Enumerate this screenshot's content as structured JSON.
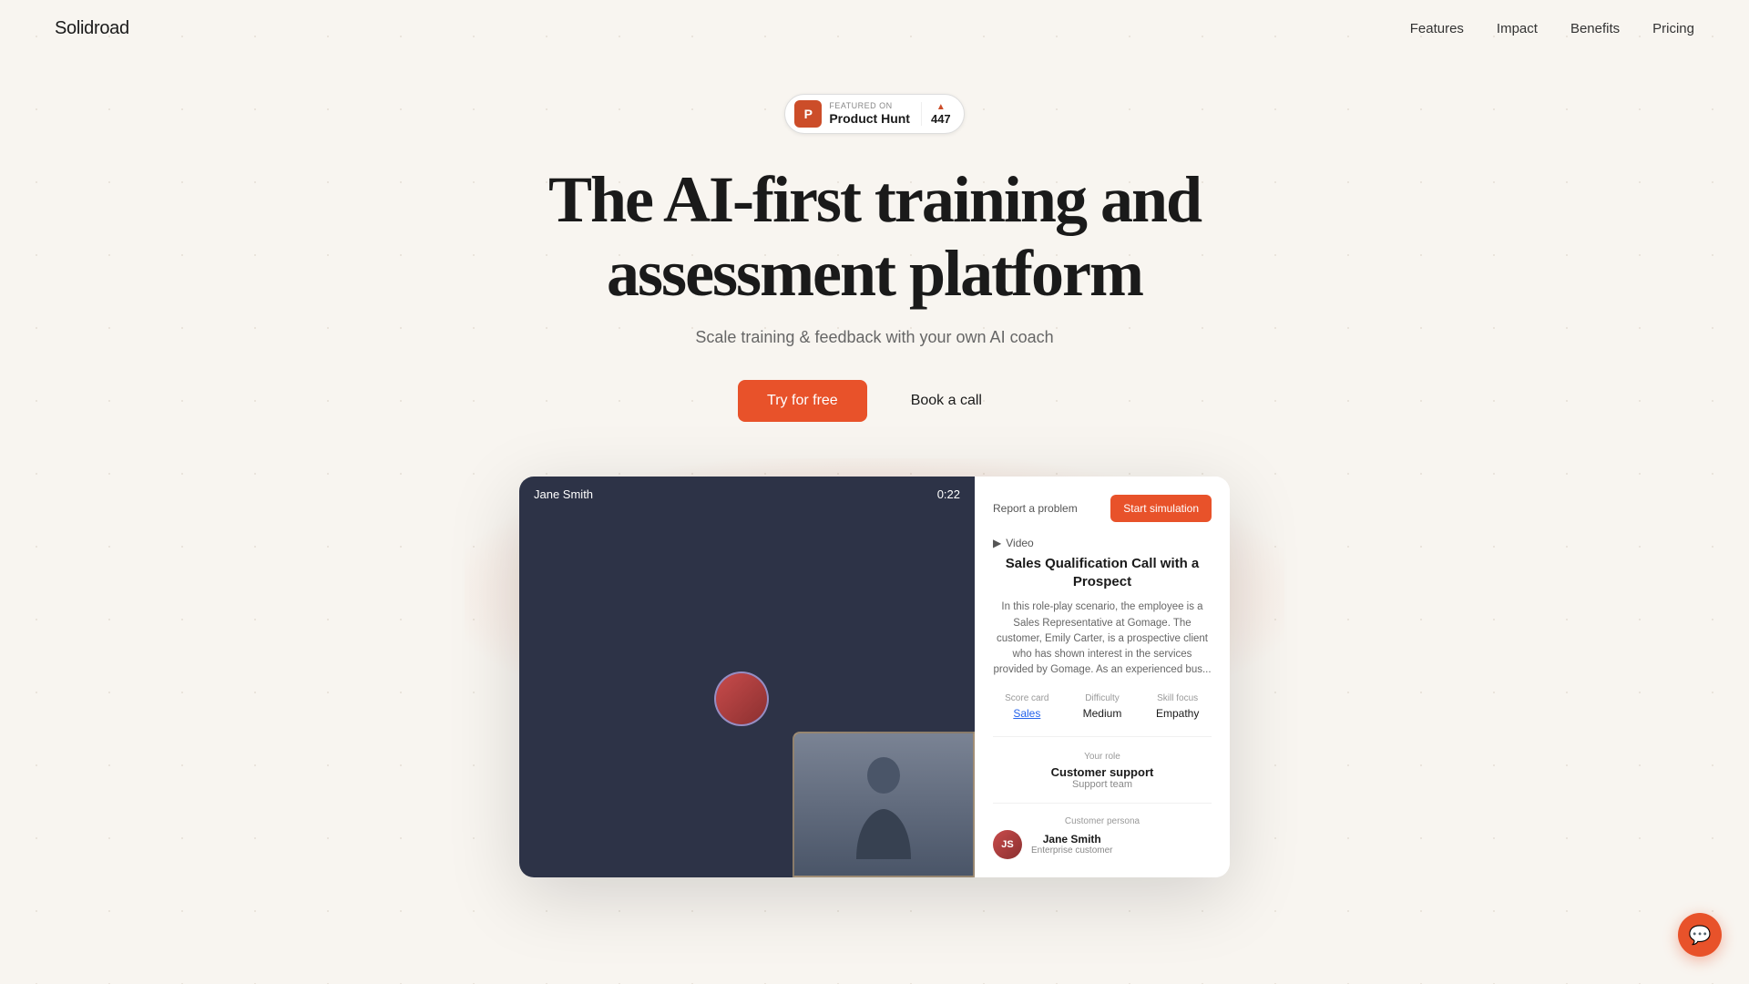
{
  "brand": {
    "name": "Solidroad"
  },
  "nav": {
    "links": [
      {
        "id": "features",
        "label": "Features"
      },
      {
        "id": "impact",
        "label": "Impact"
      },
      {
        "id": "benefits",
        "label": "Benefits"
      },
      {
        "id": "pricing",
        "label": "Pricing"
      }
    ]
  },
  "product_hunt": {
    "featured_label": "FEATURED ON",
    "name": "Product Hunt",
    "vote_count": "447",
    "logo_letter": "P"
  },
  "hero": {
    "headline_line1": "The AI-first training and",
    "headline_line2": "assessment platform",
    "subtitle": "Scale training & feedback with your own AI coach",
    "cta_primary": "Try for free",
    "cta_secondary": "Book a call"
  },
  "demo": {
    "video": {
      "person_name": "Jane Smith",
      "timer": "0:22"
    },
    "panel": {
      "report_label": "Report a problem",
      "start_label": "Start simulation",
      "type_label": "Video",
      "scenario_title": "Sales Qualification Call with a Prospect",
      "scenario_desc": "In this role-play scenario, the employee is a Sales Representative at Gomage. The customer, Emily Carter, is a prospective client who has shown interest in the services provided by Gomage. As an experienced bus...",
      "score_card_label": "Score card",
      "score_card_value": "Sales",
      "difficulty_label": "Difficulty",
      "difficulty_value": "Medium",
      "skill_focus_label": "Skill focus",
      "skill_focus_value": "Empathy",
      "role_section_label": "Your role",
      "role_name": "Customer support",
      "role_team": "Support team",
      "persona_section_label": "Customer persona",
      "persona_name": "Jane Smith",
      "persona_type": "Enterprise customer"
    }
  },
  "chat": {
    "icon": "💬"
  }
}
